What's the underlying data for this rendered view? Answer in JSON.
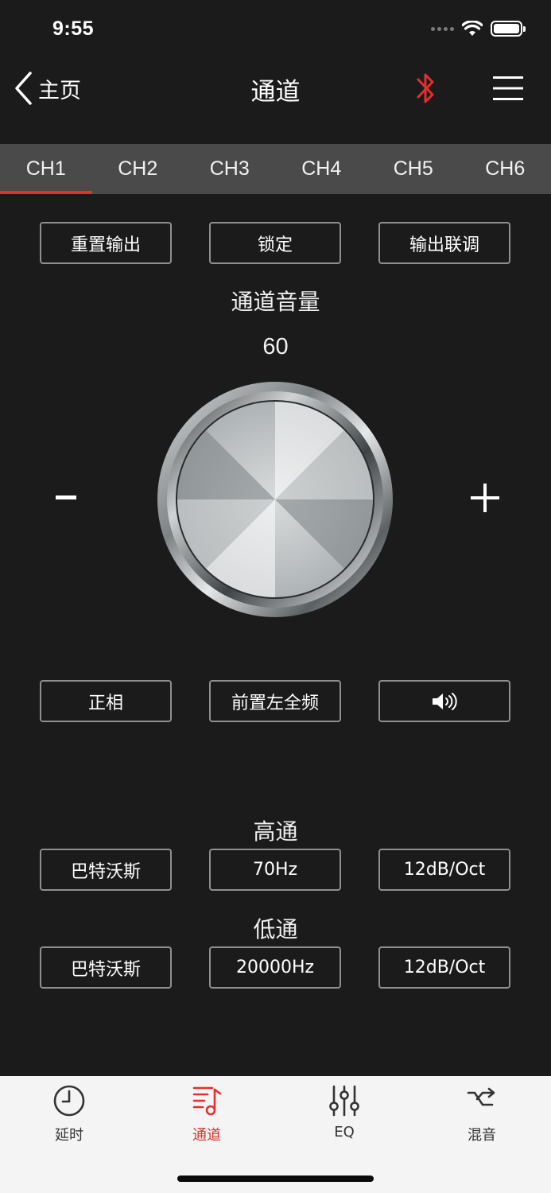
{
  "status_bar": {
    "time": "9:55",
    "icons": [
      "signal-dots-icon",
      "wifi-icon",
      "battery-icon"
    ]
  },
  "nav": {
    "back_label": "主页",
    "title": "通道",
    "bluetooth_icon": "bluetooth-icon",
    "menu_icon": "hamburger-menu-icon"
  },
  "channel_tabs": [
    "CH1",
    "CH2",
    "CH3",
    "CH4",
    "CH5",
    "CH6"
  ],
  "active_channel": "CH1",
  "top_buttons": {
    "reset": "重置输出",
    "lock": "锁定",
    "link": "输出联调"
  },
  "volume": {
    "label": "通道音量",
    "value": "60"
  },
  "mid_buttons": {
    "phase": "正相",
    "position": "前置左全频",
    "mute_icon": "speaker-volume-icon"
  },
  "high_pass": {
    "label": "高通",
    "type": "巴特沃斯",
    "freq": "70Hz",
    "slope": "12dB/Oct"
  },
  "low_pass": {
    "label": "低通",
    "type": "巴特沃斯",
    "freq": "20000Hz",
    "slope": "12dB/Oct"
  },
  "bottom_tabs": [
    {
      "label": "延时",
      "icon": "clock-icon"
    },
    {
      "label": "通道",
      "icon": "music-list-icon"
    },
    {
      "label": "EQ",
      "icon": "sliders-icon"
    },
    {
      "label": "混音",
      "icon": "shuffle-icon"
    }
  ],
  "colors": {
    "accent": "#e0302f",
    "background": "#1b1b1b",
    "tabbar": "#4a4a4a",
    "bottombar": "#f4f4f4"
  }
}
